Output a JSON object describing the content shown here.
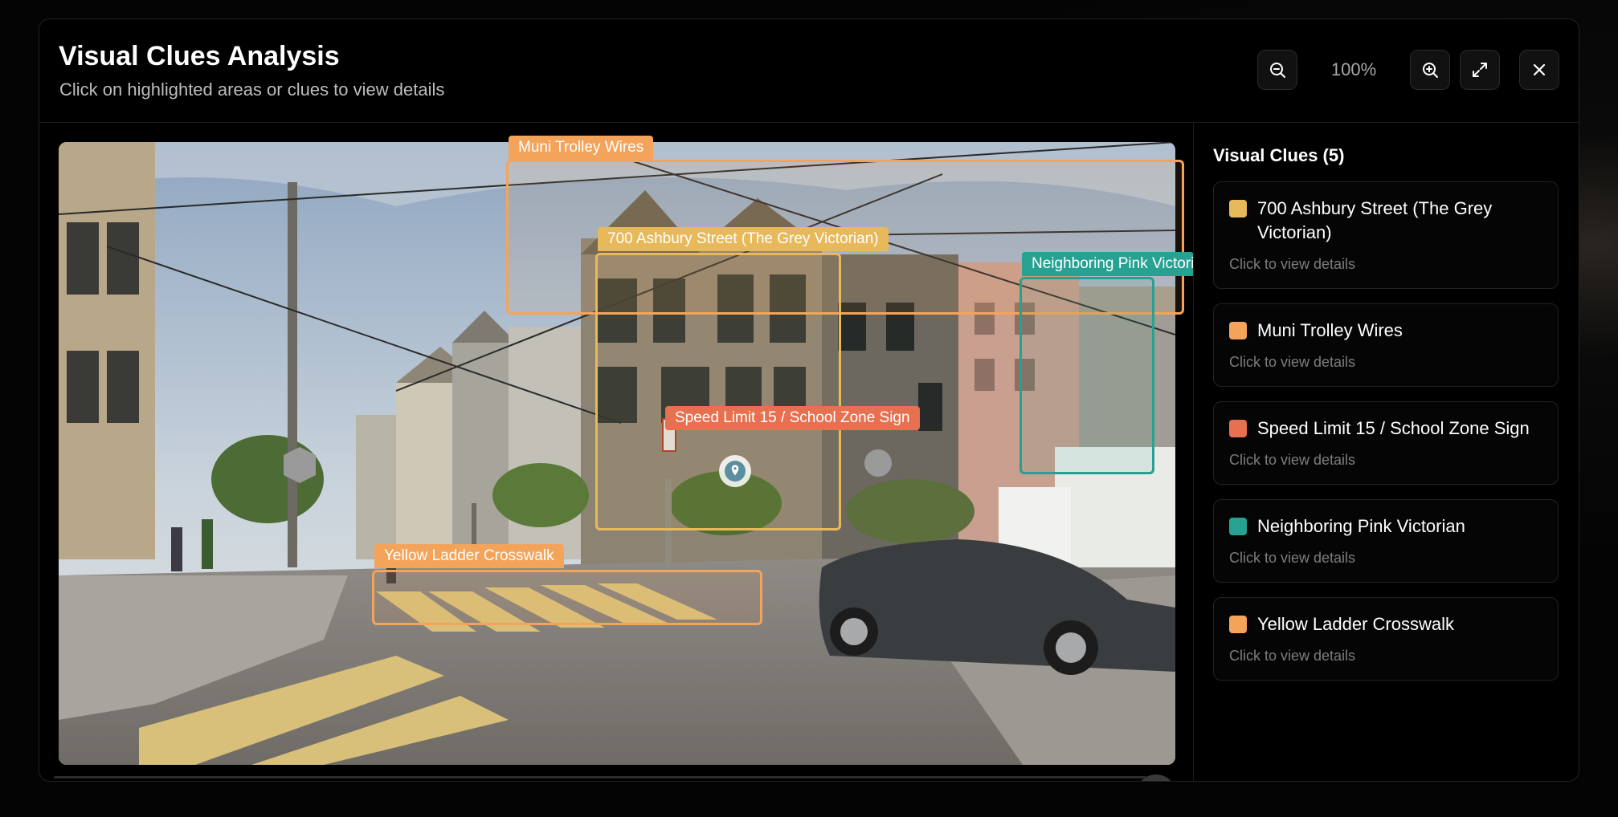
{
  "dialog": {
    "title": "Visual Clues Analysis",
    "subtitle": "Click on highlighted areas or clues to view details",
    "zoom_level": "100%",
    "icons": {
      "zoom_out": "zoom-out-icon",
      "zoom_in": "zoom-in-icon",
      "fullscreen": "expand-icon",
      "close": "close-icon",
      "marker": "location-pin-icon"
    }
  },
  "panel": {
    "title": "Visual Clues (5)",
    "hint": "Click to view details",
    "clues": [
      {
        "name": "700 Ashbury Street (The Grey Victorian)",
        "color": "#e8b95b"
      },
      {
        "name": "Muni Trolley Wires",
        "color": "#f4a45a"
      },
      {
        "name": "Speed Limit 15 / School Zone Sign",
        "color": "#e6704f"
      },
      {
        "name": "Neighboring Pink Victorian",
        "color": "#26a192"
      },
      {
        "name": "Yellow Ladder Crosswalk",
        "color": "#f4a45a"
      }
    ]
  },
  "overlays": {
    "trolley": "Muni Trolley Wires",
    "ashbury": "700 Ashbury Street (The Grey Victorian)",
    "pink": "Neighboring Pink Victorian",
    "speed": "Speed Limit 15 / School Zone Sign",
    "crosswalk": "Yellow Ladder Crosswalk"
  }
}
